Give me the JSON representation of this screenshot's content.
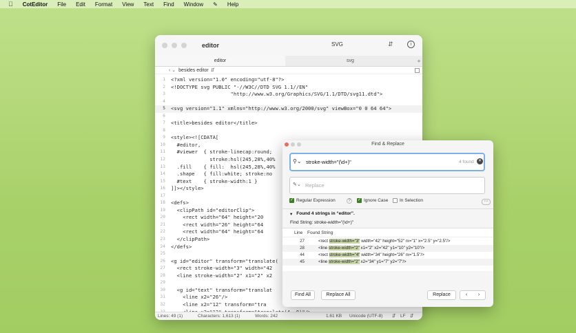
{
  "menubar": {
    "app_name": "CotEditor",
    "items": [
      "File",
      "Edit",
      "Format",
      "View",
      "Text",
      "Find",
      "Window",
      "Help"
    ]
  },
  "editor": {
    "window_title": "editor",
    "syntax": "SVG",
    "tabs": [
      {
        "label": "editor"
      },
      {
        "label": "svg"
      }
    ],
    "tab_add": "+",
    "navbar_path": "besides editor",
    "lines": [
      {
        "n": "1",
        "text": "<?xml version=\"1.0\" encoding=\"utf-8\"?>"
      },
      {
        "n": "2",
        "text": "<!DOCTYPE svg PUBLIC \"-//W3C//DTD SVG 1.1//EN\""
      },
      {
        "n": "3",
        "text": "                    \"http://www.w3.org/Graphics/SVG/1.1/DTD/svg11.dtd\">"
      },
      {
        "n": "4",
        "text": ""
      },
      {
        "n": "5",
        "text": "<svg version=\"1.1\" xmlns=\"http://www.w3.org/2000/svg\" viewBox=\"0 0 64 64\">"
      },
      {
        "n": "6",
        "text": ""
      },
      {
        "n": "7",
        "text": "<title>besides editor</title>"
      },
      {
        "n": "8",
        "text": ""
      },
      {
        "n": "9",
        "text": "<style><![CDATA["
      },
      {
        "n": "10",
        "text": "  #editor,"
      },
      {
        "n": "11",
        "text": "  #viewer  { stroke-linecap:round;"
      },
      {
        "n": "12",
        "text": "             stroke:hsl(245,28%,40%"
      },
      {
        "n": "13",
        "text": "  .fill    { fill:  hsl(245,28%,40%"
      },
      {
        "n": "14",
        "text": "  .shape   { fill:white; stroke:no"
      },
      {
        "n": "15",
        "text": "  #text    { stroke-width:1 }"
      },
      {
        "n": "16",
        "text": "]]></style>"
      },
      {
        "n": "17",
        "text": ""
      },
      {
        "n": "18",
        "text": "<defs>"
      },
      {
        "n": "19",
        "text": "  <clipPath id=\"editorClip\">"
      },
      {
        "n": "20",
        "text": "    <rect width=\"64\" height=\"20"
      },
      {
        "n": "21",
        "text": "    <rect width=\"26\" height=\"64"
      },
      {
        "n": "22",
        "text": "    <rect width=\"64\" height=\"64"
      },
      {
        "n": "23",
        "text": "  </clipPath>"
      },
      {
        "n": "24",
        "text": "</defs>"
      },
      {
        "n": "25",
        "text": ""
      },
      {
        "n": "26",
        "text": "<g id=\"editor\" transform=\"translate("
      },
      {
        "n": "27",
        "text": "  <rect stroke-width=\"3\" width=\"42"
      },
      {
        "n": "28",
        "text": "  <line stroke-width=\"2\" x1=\"2\" x2"
      },
      {
        "n": "29",
        "text": ""
      },
      {
        "n": "30",
        "text": "  <g id=\"text\" transform=\"translat"
      },
      {
        "n": "31",
        "text": "    <line x2=\"26\"/>"
      },
      {
        "n": "32",
        "text": "    <line x2=\"12\" transform=\"tra"
      },
      {
        "n": "33",
        "text": "    <line x2=\"12\" transform=\"translate(4, 8)\"/>"
      }
    ],
    "status": {
      "lines": "Lines: 49 (1)",
      "characters": "Characters: 1,613 (1)",
      "words": "Words: 242",
      "size": "1.61 KB",
      "encoding": "Unicode (UTF-8)",
      "line_ending": "LF"
    }
  },
  "find": {
    "title": "Find & Replace",
    "query": "stroke-width=\"(\\d+)\"",
    "found_count": "4 found",
    "replace_placeholder": "Replace",
    "options": [
      {
        "label": "Regular Expression",
        "checked": true
      },
      {
        "label": "Ignore Case",
        "checked": true
      },
      {
        "label": "In Selection",
        "checked": false
      }
    ],
    "result_summary": "Found 4 strings in “editor”.",
    "find_string": "Find String: stroke-width=\"(\\d+)\"",
    "columns": [
      "Line",
      "Found String"
    ],
    "results": [
      {
        "line": "27",
        "pre": "<rect ",
        "match": "stroke-width=\"3\"",
        "post": " width=\"42\" height=\"52\" rx=\"1\" x=\"2.5\" y=\"2.5\"/>"
      },
      {
        "line": "28",
        "pre": "<line ",
        "match": "stroke-width=\"2\"",
        "post": " x1=\"2\" x2=\"42\" y1=\"10\" y2=\"10\"/>"
      },
      {
        "line": "44",
        "pre": "<rect ",
        "match": "stroke-width=\"4\"",
        "post": " width=\"34\" height=\"26\" rx=\"1.5\"/>"
      },
      {
        "line": "45",
        "pre": "<line ",
        "match": "stroke-width=\"2\"",
        "post": " x2=\"34\" y1=\"7\" y2=\"7\"/>"
      }
    ],
    "buttons": {
      "find_all": "Find All",
      "replace_all": "Replace All",
      "replace": "Replace",
      "prev": "‹",
      "next": "›"
    }
  }
}
